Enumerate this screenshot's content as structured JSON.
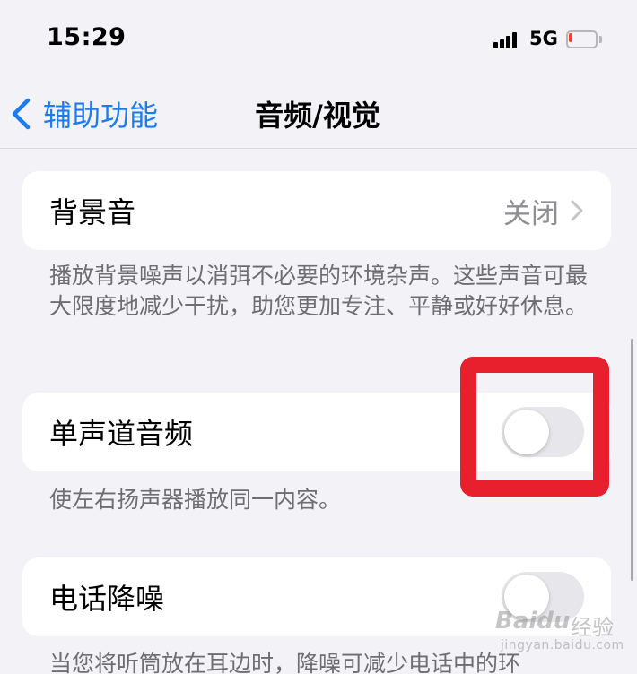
{
  "status_bar": {
    "time": "15:29",
    "network": "5G",
    "battery_level": 0.15,
    "battery_color": "#ff3b30"
  },
  "nav": {
    "back_label": "辅助功能",
    "title": "音频/视觉",
    "accent_color": "#1b7cf2"
  },
  "settings": [
    {
      "label": "背景音",
      "value": "关闭",
      "type": "disclosure",
      "footer": "播放背景噪声以消弭不必要的环境杂声。这些声音可最大限度地减少干扰，助您更加专注、平静或好好休息。"
    },
    {
      "label": "单声道音频",
      "type": "toggle",
      "on": false,
      "footer": "使左右扬声器播放同一内容。"
    },
    {
      "label": "电话降噪",
      "type": "toggle",
      "on": false,
      "footer": "当您将听筒放在耳边时，降噪可减少电话中的环"
    }
  ],
  "annotation": {
    "highlight_color": "#e8202e",
    "target": "单声道音频 toggle"
  },
  "watermark": {
    "logo": "Baidu",
    "sub": "经验",
    "url": "jingyan.baidu.com"
  }
}
